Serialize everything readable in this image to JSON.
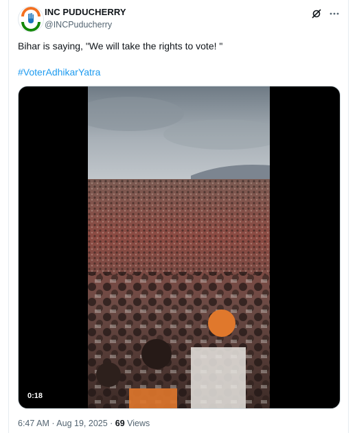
{
  "author": {
    "display_name": "INC PUDUCHERRY",
    "handle": "@INCPuducherry",
    "avatar_icon": "congress-hand-logo"
  },
  "header_icons": [
    "grok-icon",
    "more-icon"
  ],
  "tweet": {
    "text": "Bihar is saying, \"We will take the rights to vote! \"",
    "hashtag": "#VoterAdhikarYatra"
  },
  "media": {
    "type": "video",
    "duration": "0:18"
  },
  "footer": {
    "time": "6:47 AM",
    "separator1": " · ",
    "date": "Aug 19, 2025",
    "separator2": " · ",
    "views_count": "69",
    "views_label": " Views"
  },
  "colors": {
    "link": "#1d9bf0",
    "muted": "#536471",
    "text": "#0f1419",
    "logo_orange": "#f37021",
    "logo_green": "#138808"
  }
}
